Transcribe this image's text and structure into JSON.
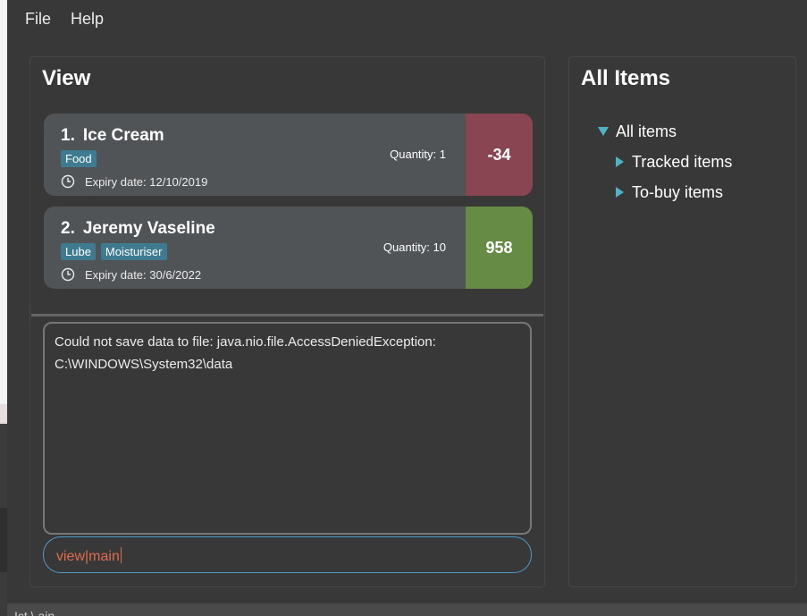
{
  "menu": {
    "file": "File",
    "help": "Help"
  },
  "view_panel": {
    "title": "View",
    "items": [
      {
        "index": "1.",
        "name": "Ice Cream",
        "tags": [
          "Food"
        ],
        "expiry": "Expiry date: 12/10/2019",
        "quantity": "Quantity: 1",
        "count": "-34",
        "count_color": "#894552"
      },
      {
        "index": "2.",
        "name": "Jeremy Vaseline",
        "tags": [
          "Lube",
          "Moisturiser"
        ],
        "expiry": "Expiry date: 30/6/2022",
        "quantity": "Quantity: 10",
        "count": "958",
        "count_color": "#658b45"
      }
    ],
    "result_message": "Could not save data to file: java.nio.file.AccessDeniedException:\nC:\\WINDOWS\\System32\\data",
    "command_input": "view|main"
  },
  "all_items_panel": {
    "title": "All Items",
    "tree": {
      "root": "All items",
      "children": [
        "Tracked items",
        "To-buy items"
      ]
    }
  },
  "status_bar": {
    "text": "Ict \\ ain"
  },
  "colors": {
    "tag_bg": "#3e7b91",
    "tree_arrow": "#4fb3c8",
    "command_text": "#e06c50",
    "command_border": "#4d9acb"
  }
}
